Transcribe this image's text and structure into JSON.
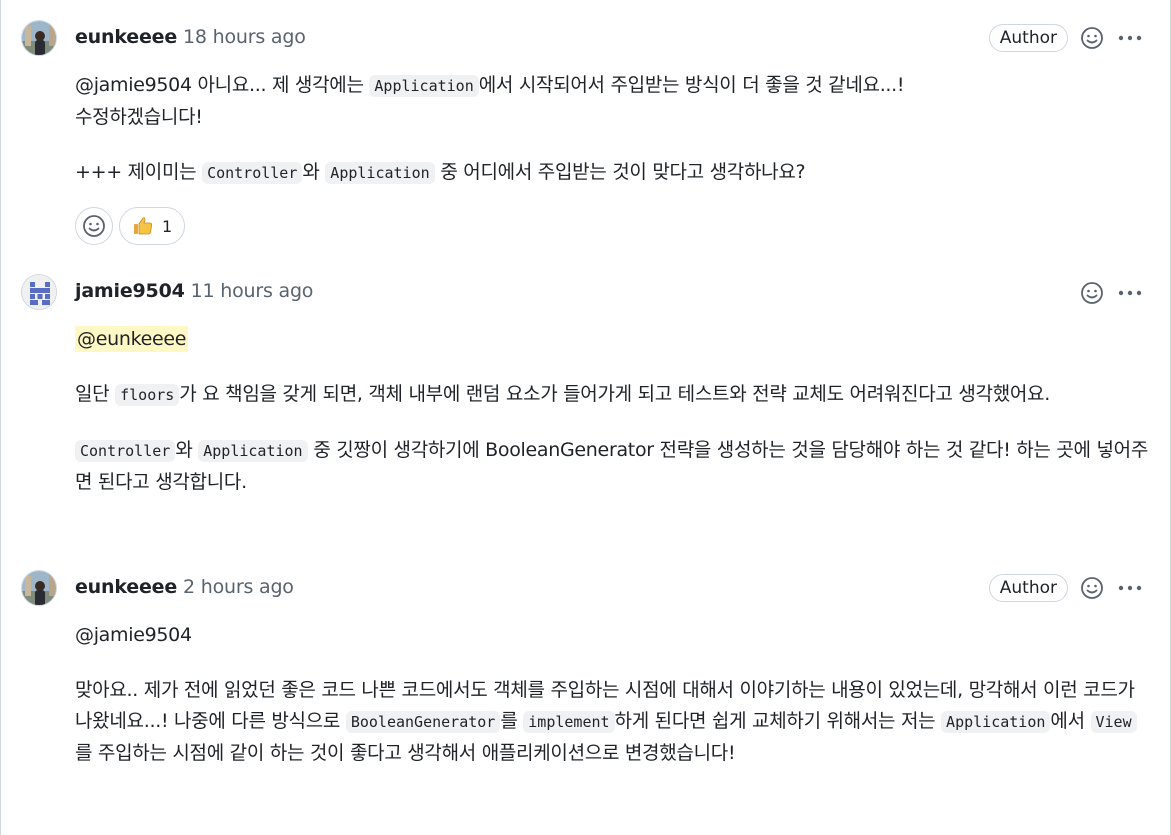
{
  "comments": [
    {
      "author": "eunkeeee",
      "time": "18 hours ago",
      "badge": "Author",
      "avatar_icon": "user-avatar-photo",
      "p1_mention": "@jamie9504",
      "p1_a": " 아니요... 제 생각에는 ",
      "p1_code1": "Application",
      "p1_b": "에서 시작되어서 주입받는 방식이 더 좋을 것 같네요...!",
      "p1_c": "수정하겠습니다!",
      "p2_a": "+++ 제이미는 ",
      "p2_code1": "Controller",
      "p2_b": "와 ",
      "p2_code2": "Application",
      "p2_c": " 중 어디에서 주입받는 것이 맞다고 생각하나요?",
      "reaction": {
        "icon": "thumbs-up-icon",
        "count": "1"
      }
    },
    {
      "author": "jamie9504",
      "time": "11 hours ago",
      "avatar_icon": "identicon-avatar",
      "mention": "@eunkeeee",
      "p1_a": "일단 ",
      "p1_code1": "floors",
      "p1_b": "가 요 책임을 갖게 되면, 객체 내부에 랜덤 요소가 들어가게 되고 테스트와 전략 교체도 어려워진다고 생각했어요.",
      "p2_code1": "Controller",
      "p2_a": "와 ",
      "p2_code2": "Application",
      "p2_b": " 중 깃짱이 생각하기에 BooleanGenerator 전략을 생성하는 것을 담당해야 하는 것 같다! 하는 곳에 넣어주면 된다고 생각합니다."
    },
    {
      "author": "eunkeeee",
      "time": "2 hours ago",
      "badge": "Author",
      "avatar_icon": "user-avatar-photo",
      "mention": "@jamie9504",
      "p1_a": "맞아요.. 제가 전에 읽었던 좋은 코드 나쁜 코드에서도 객체를 주입하는 시점에 대해서 이야기하는 내용이 있었는데, 망각해서 이런 코드가 나왔네요...! 나중에 다른 방식으로 ",
      "p1_code1": "BooleanGenerator",
      "p1_b": "를 ",
      "p1_code2": "implement",
      "p1_c": "하게 된다면 쉽게 교체하기 위해서는 저는 ",
      "p1_code3": "Application",
      "p1_d": "에서 ",
      "p1_code4": "View",
      "p1_e": "를 주입하는 시점에 같이 하는 것이 좋다고 생각해서 애플리케이션으로 변경했습니다!"
    }
  ],
  "colors": {
    "muted": "#59636e",
    "border": "#d0d7de",
    "code_bg": "#eff1f3",
    "mention_highlight": "#fff8c5"
  }
}
